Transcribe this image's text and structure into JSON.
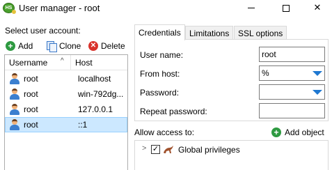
{
  "window": {
    "title": "User manager - root",
    "app_icon_text": "HS"
  },
  "left": {
    "select_label": "Select user account:",
    "toolbar": {
      "add": "Add",
      "clone": "Clone",
      "delete": "Delete"
    },
    "columns": {
      "username": "Username",
      "host": "Host"
    },
    "users": [
      {
        "username": "root",
        "host": "localhost"
      },
      {
        "username": "root",
        "host": "win-792dg..."
      },
      {
        "username": "root",
        "host": "127.0.0.1"
      },
      {
        "username": "root",
        "host": "::1",
        "selected": true
      }
    ]
  },
  "right": {
    "tabs": [
      "Credentials",
      "Limitations",
      "SSL options"
    ],
    "active_tab": "Credentials",
    "fields": {
      "user_name": {
        "label": "User name:",
        "value": "root"
      },
      "from_host": {
        "label": "From host:",
        "value": "%"
      },
      "password": {
        "label": "Password:",
        "value": ""
      },
      "repeat_password": {
        "label": "Repeat password:",
        "value": ""
      }
    },
    "access_label": "Allow access to:",
    "add_object": "Add object",
    "tree": [
      {
        "label": "Global privileges",
        "checked": true
      }
    ]
  },
  "colors": {
    "selection": "#cce8ff",
    "add_green": "#2e9a41",
    "delete_red": "#d9322b",
    "dropdown_blue": "#1f78d1"
  },
  "icons": [
    "app-icon",
    "add-icon",
    "clone-icon",
    "delete-icon",
    "user-icon",
    "dropdown-arrow-icon",
    "expand-icon",
    "checkbox",
    "global-privileges-icon"
  ]
}
